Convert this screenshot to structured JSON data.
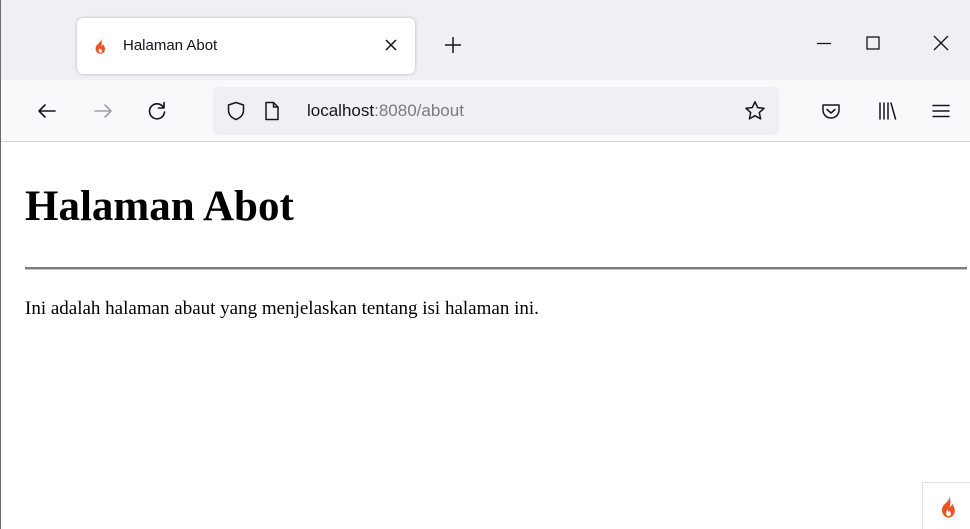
{
  "browser": {
    "tab": {
      "title": "Halaman Abot",
      "favicon": "codeigniter-flame-icon",
      "close_icon": "close-icon"
    },
    "new_tab_icon": "plus-icon",
    "window_controls": [
      "minimize-icon",
      "maximize-icon",
      "close-icon"
    ],
    "nav": {
      "back_icon": "arrow-left-icon",
      "forward_icon": "arrow-right-icon",
      "reload_icon": "reload-icon"
    },
    "urlbar": {
      "host": "localhost",
      "rest": ":8080/about",
      "shield_icon": "shield-icon",
      "page_icon": "page-icon",
      "bookmark_icon": "star-icon"
    },
    "toolbar_icons": [
      "pocket-icon",
      "library-icon",
      "menu-icon"
    ]
  },
  "page": {
    "heading": "Halaman Abot",
    "paragraph": "Ini adalah halaman abaut yang menjelaskan tentang isi halaman ini."
  },
  "debug_toolbar": {
    "icon": "codeigniter-flame-icon"
  },
  "colors": {
    "flame": "#e95420",
    "tabstrip_bg": "#f0f0f4",
    "toolbar_bg": "#f9f9fb",
    "urlbar_bg": "#f0f0f4"
  }
}
